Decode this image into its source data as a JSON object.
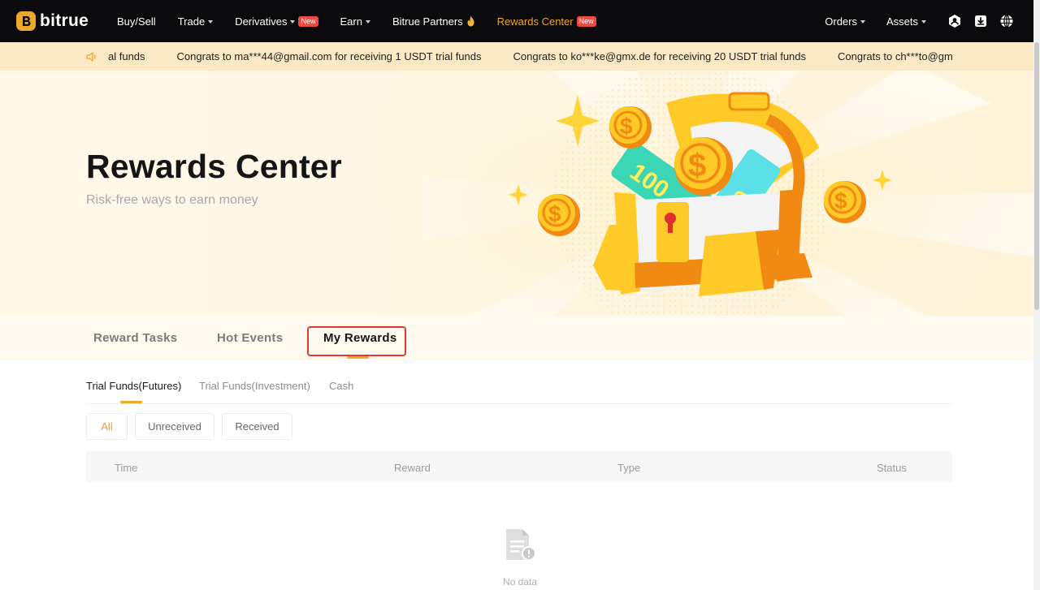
{
  "brand": {
    "name": "bitrue"
  },
  "nav": {
    "items": [
      {
        "label": "Buy/Sell"
      },
      {
        "label": "Trade"
      },
      {
        "label": "Derivatives",
        "badge": "New"
      },
      {
        "label": "Earn"
      },
      {
        "label": "Bitrue Partners"
      },
      {
        "label": "Rewards Center",
        "badge": "New"
      }
    ],
    "orders_label": "Orders",
    "assets_label": "Assets"
  },
  "ticker": {
    "messages": [
      "al funds",
      "Congrats to ma***44@gmail.com for receiving 1 USDT trial funds",
      "Congrats to ko***ke@gmx.de for receiving 20 USDT trial funds",
      "Congrats to ch***to@gmail.com"
    ]
  },
  "hero": {
    "title": "Rewards Center",
    "subtitle": "Risk-free ways to earn money"
  },
  "main_tabs": [
    {
      "label": "Reward Tasks"
    },
    {
      "label": "Hot Events"
    },
    {
      "label": "My Rewards"
    }
  ],
  "sub_tabs": [
    {
      "label": "Trial Funds(Futures)"
    },
    {
      "label": "Trial Funds(Investment)"
    },
    {
      "label": "Cash"
    }
  ],
  "filters": [
    {
      "label": "All"
    },
    {
      "label": "Unreceived"
    },
    {
      "label": "Received"
    }
  ],
  "table": {
    "columns": [
      "Time",
      "Reward",
      "Type",
      "Status"
    ]
  },
  "empty_state": {
    "text": "No data"
  },
  "colors": {
    "accent": "#f0a829",
    "badge": "#f0473f",
    "highlight": "#e23b2e"
  }
}
